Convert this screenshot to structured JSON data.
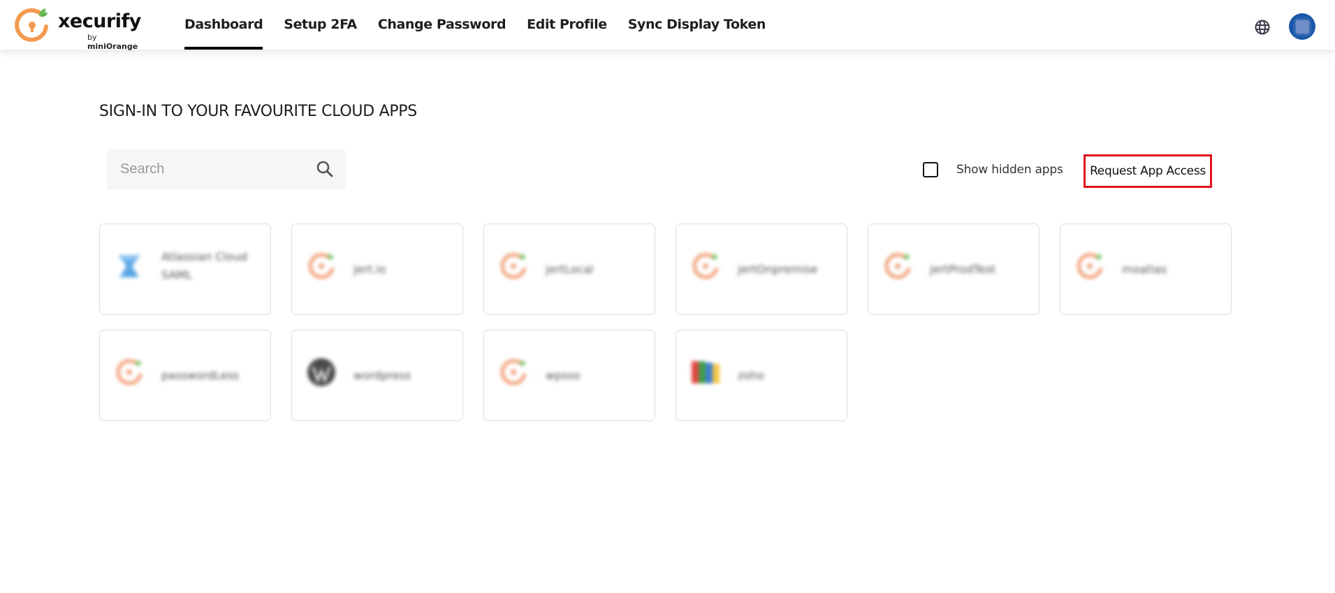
{
  "brand": {
    "name": "xecurify",
    "by_prefix": "by ",
    "by_company": "miniOrange",
    "colors": {
      "orange": "#f39a4f",
      "leaf": "#6bbf5b"
    }
  },
  "nav": {
    "items": [
      {
        "label": "Dashboard",
        "active": true
      },
      {
        "label": "Setup 2FA",
        "active": false
      },
      {
        "label": "Change Password",
        "active": false
      },
      {
        "label": "Edit Profile",
        "active": false
      },
      {
        "label": "Sync Display Token",
        "active": false
      }
    ],
    "globe_icon": "globe-icon",
    "avatar_color": "#1859a9"
  },
  "main": {
    "title": "SIGN-IN TO YOUR FAVOURITE CLOUD APPS",
    "search": {
      "placeholder": "Search",
      "value": "",
      "icon": "search-icon"
    },
    "show_hidden": {
      "label": "Show hidden apps",
      "checked": false
    },
    "request_access": {
      "label": "Request App Access",
      "highlight_color": "#e0121c"
    }
  },
  "apps": [
    {
      "name": "Atlassian Cloud SAML",
      "logo": "atlassian"
    },
    {
      "name": "jert.io",
      "logo": "xecurify"
    },
    {
      "name": "jertLocal",
      "logo": "xecurify"
    },
    {
      "name": "jertOnpremise",
      "logo": "xecurify"
    },
    {
      "name": "jertProdTest",
      "logo": "xecurify"
    },
    {
      "name": "moatlas",
      "logo": "xecurify"
    },
    {
      "name": "passwordLess",
      "logo": "xecurify"
    },
    {
      "name": "wordpress",
      "logo": "wordpress"
    },
    {
      "name": "wpsso",
      "logo": "xecurify"
    },
    {
      "name": "zoho",
      "logo": "zoho"
    }
  ]
}
